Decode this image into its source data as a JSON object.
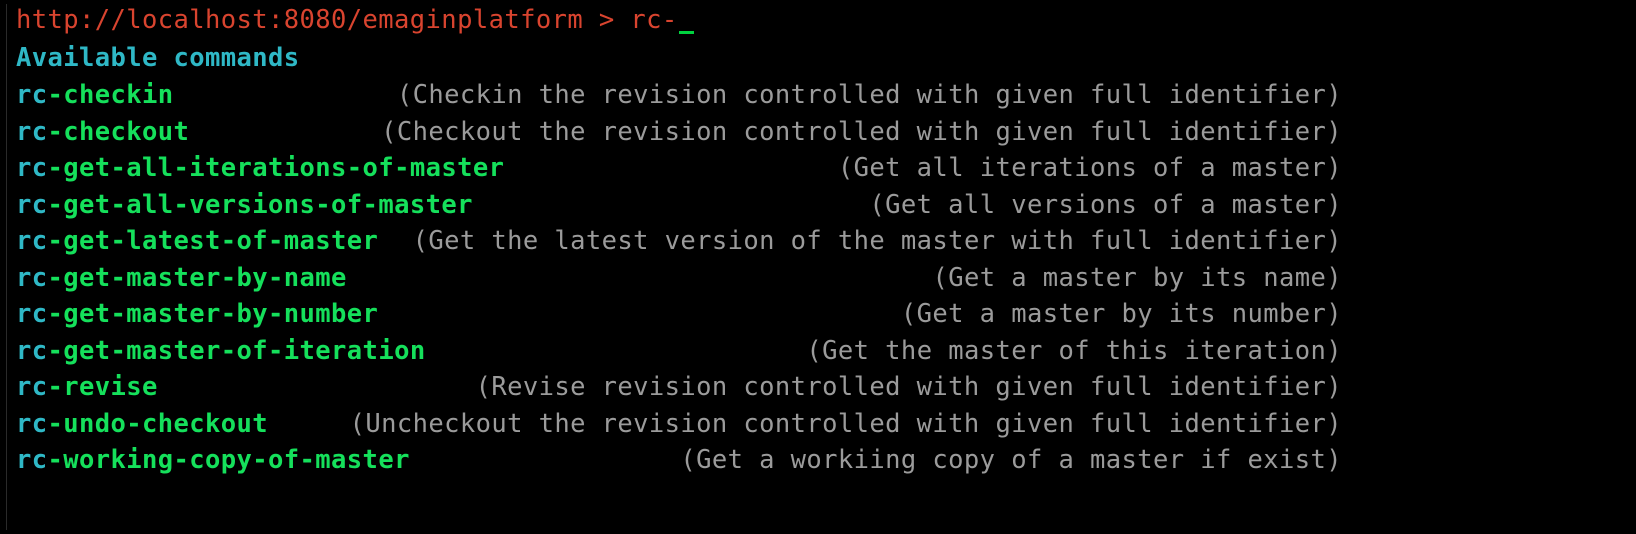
{
  "prompt": {
    "url": "http://localhost:8080/emaginplatform",
    "separator": " > ",
    "input": "rc-"
  },
  "header": "Available commands",
  "commands": [
    {
      "prefix": "rc",
      "name": "-checkin",
      "description": "(Checkin the revision controlled with given full identifier)"
    },
    {
      "prefix": "rc",
      "name": "-checkout",
      "description": "(Checkout the revision controlled with given full identifier)"
    },
    {
      "prefix": "rc",
      "name": "-get-all-iterations-of-master",
      "description": "(Get all iterations of a master)"
    },
    {
      "prefix": "rc",
      "name": "-get-all-versions-of-master",
      "description": "(Get all versions of a master)"
    },
    {
      "prefix": "rc",
      "name": "-get-latest-of-master",
      "description": "(Get the latest version of the master with full identifier)"
    },
    {
      "prefix": "rc",
      "name": "-get-master-by-name",
      "description": "(Get a master by its name)"
    },
    {
      "prefix": "rc",
      "name": "-get-master-by-number",
      "description": "(Get a master by its number)"
    },
    {
      "prefix": "rc",
      "name": "-get-master-of-iteration",
      "description": "(Get the master of this iteration)"
    },
    {
      "prefix": "rc",
      "name": "-revise",
      "description": "(Revise revision controlled with given full identifier)"
    },
    {
      "prefix": "rc",
      "name": "-undo-checkout",
      "description": "(Uncheckout the revision controlled with given full identifier)"
    },
    {
      "prefix": "rc",
      "name": "-working-copy-of-master",
      "description": "(Get a workiing copy of a master if exist)"
    }
  ],
  "colors": {
    "background": "#000000",
    "prompt": "#d9442f",
    "header": "#2fb8c6",
    "command": "#15e05b",
    "command_prefix": "#2fb8c6",
    "description": "#9b9b9b",
    "cursor": "#00d23f"
  }
}
